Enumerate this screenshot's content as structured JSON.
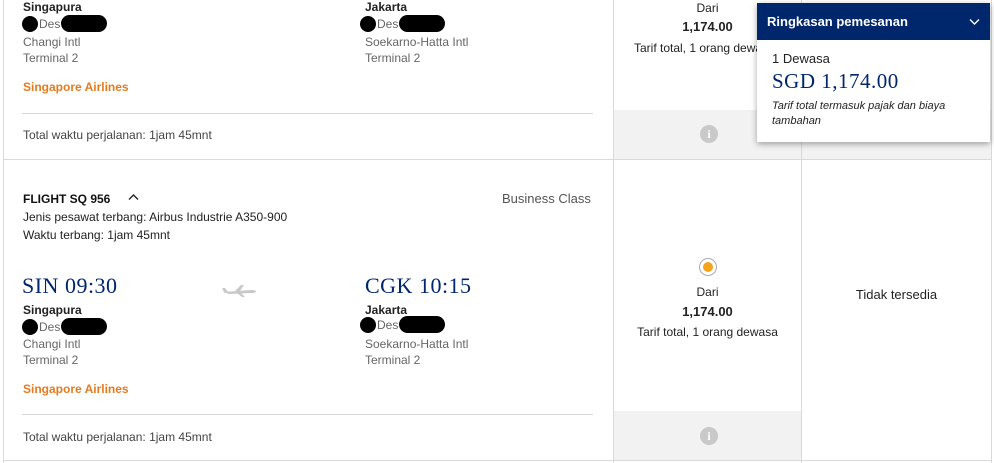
{
  "flight1": {
    "origin_city": "Singapura",
    "origin_date": "Des",
    "origin_airport": "Changi Intl",
    "origin_terminal": "Terminal 2",
    "dest_city": "Jakarta",
    "dest_date": "Des",
    "dest_airport": "Soekarno-Hatta Intl",
    "dest_terminal": "Terminal 2",
    "airline": "Singapore Airlines",
    "total_time": "Total waktu perjalanan: 1jam 45mnt",
    "fare_from": "Dari",
    "fare_price": "1,174.00",
    "fare_note": "Tarif total, 1 orang dewasa"
  },
  "flight2": {
    "flight_no": "FLIGHT SQ 956",
    "class": "Business Class",
    "aircraft": "Jenis pesawat terbang: Airbus Industrie A350-900",
    "duration": "Waktu terbang: 1jam 45mnt",
    "dep_time": "SIN 09:30",
    "arr_time": "CGK 10:15",
    "origin_city": "Singapura",
    "origin_date": "Des",
    "origin_airport": "Changi Intl",
    "origin_terminal": "Terminal 2",
    "dest_city": "Jakarta",
    "dest_date": "Des",
    "dest_airport": "Soekarno-Hatta Intl",
    "dest_terminal": "Terminal 2",
    "airline": "Singapore Airlines",
    "total_time": "Total waktu perjalanan: 1jam 45mnt",
    "fare_from": "Dari",
    "fare_price": "1,174.00",
    "fare_note": "Tarif total, 1 orang dewasa",
    "other_fare": "Tidak tersedia"
  },
  "summary": {
    "title": "Ringkasan pemesanan",
    "passengers": "1 Dewasa",
    "total": "SGD 1,174.00",
    "note": "Tarif total termasuk pajak dan biaya tambahan"
  },
  "colors": {
    "brand_navy": "#00266b",
    "airline_orange": "#e57b20",
    "radio_selected": "#f5a31a"
  },
  "icons": {
    "info": "info-icon",
    "plane": "plane-icon",
    "collapse": "chevron-up-icon",
    "dropdown": "chevron-down-icon"
  }
}
